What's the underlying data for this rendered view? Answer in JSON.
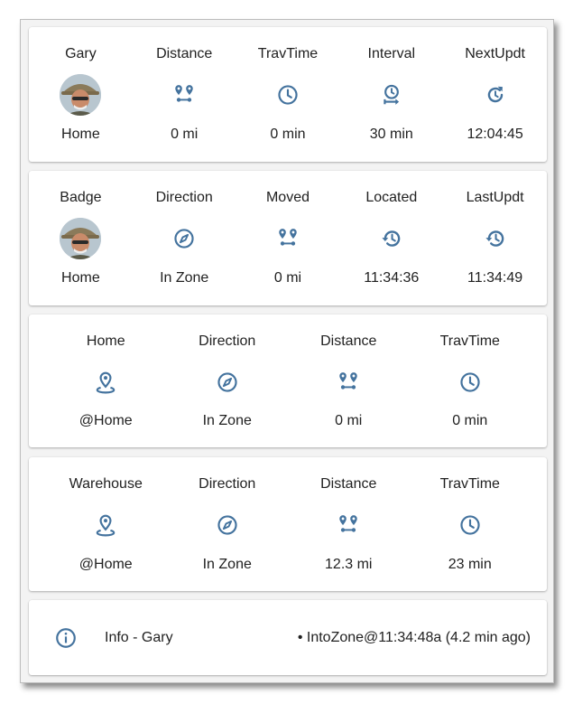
{
  "accent_color": "#44739e",
  "tracking_card": {
    "labels": [
      "Gary",
      "Distance",
      "TravTime",
      "Interval",
      "NextUpdt"
    ],
    "icons": [
      "person-avatar",
      "map-marker-distance-icon",
      "clock-icon",
      "timer-interval-icon",
      "update-icon"
    ],
    "values": [
      "Home",
      "0 mi",
      "0 min",
      "30 min",
      "12:04:45"
    ]
  },
  "badge_card": {
    "labels": [
      "Badge",
      "Direction",
      "Moved",
      "Located",
      "LastUpdt"
    ],
    "icons": [
      "person-avatar",
      "compass-icon",
      "map-marker-distance-icon",
      "history-icon",
      "history-icon"
    ],
    "values": [
      "Home",
      "In Zone",
      "0 mi",
      "11:34:36",
      "11:34:49"
    ]
  },
  "home_zone_card": {
    "labels": [
      "Home",
      "Direction",
      "Distance",
      "TravTime"
    ],
    "icons": [
      "map-marker-radius-icon",
      "compass-icon",
      "map-marker-distance-icon",
      "clock-icon"
    ],
    "values": [
      "@Home",
      "In Zone",
      "0 mi",
      "0 min"
    ]
  },
  "warehouse_zone_card": {
    "labels": [
      "Warehouse",
      "Direction",
      "Distance",
      "TravTime"
    ],
    "icons": [
      "map-marker-radius-icon",
      "compass-icon",
      "map-marker-distance-icon",
      "clock-icon"
    ],
    "values": [
      "@Home",
      "In Zone",
      "12.3 mi",
      "23 min"
    ]
  },
  "info_card": {
    "icon": "information-icon",
    "title": "Info - Gary",
    "status": "• IntoZone@11:34:48a (4.2 min ago)"
  }
}
